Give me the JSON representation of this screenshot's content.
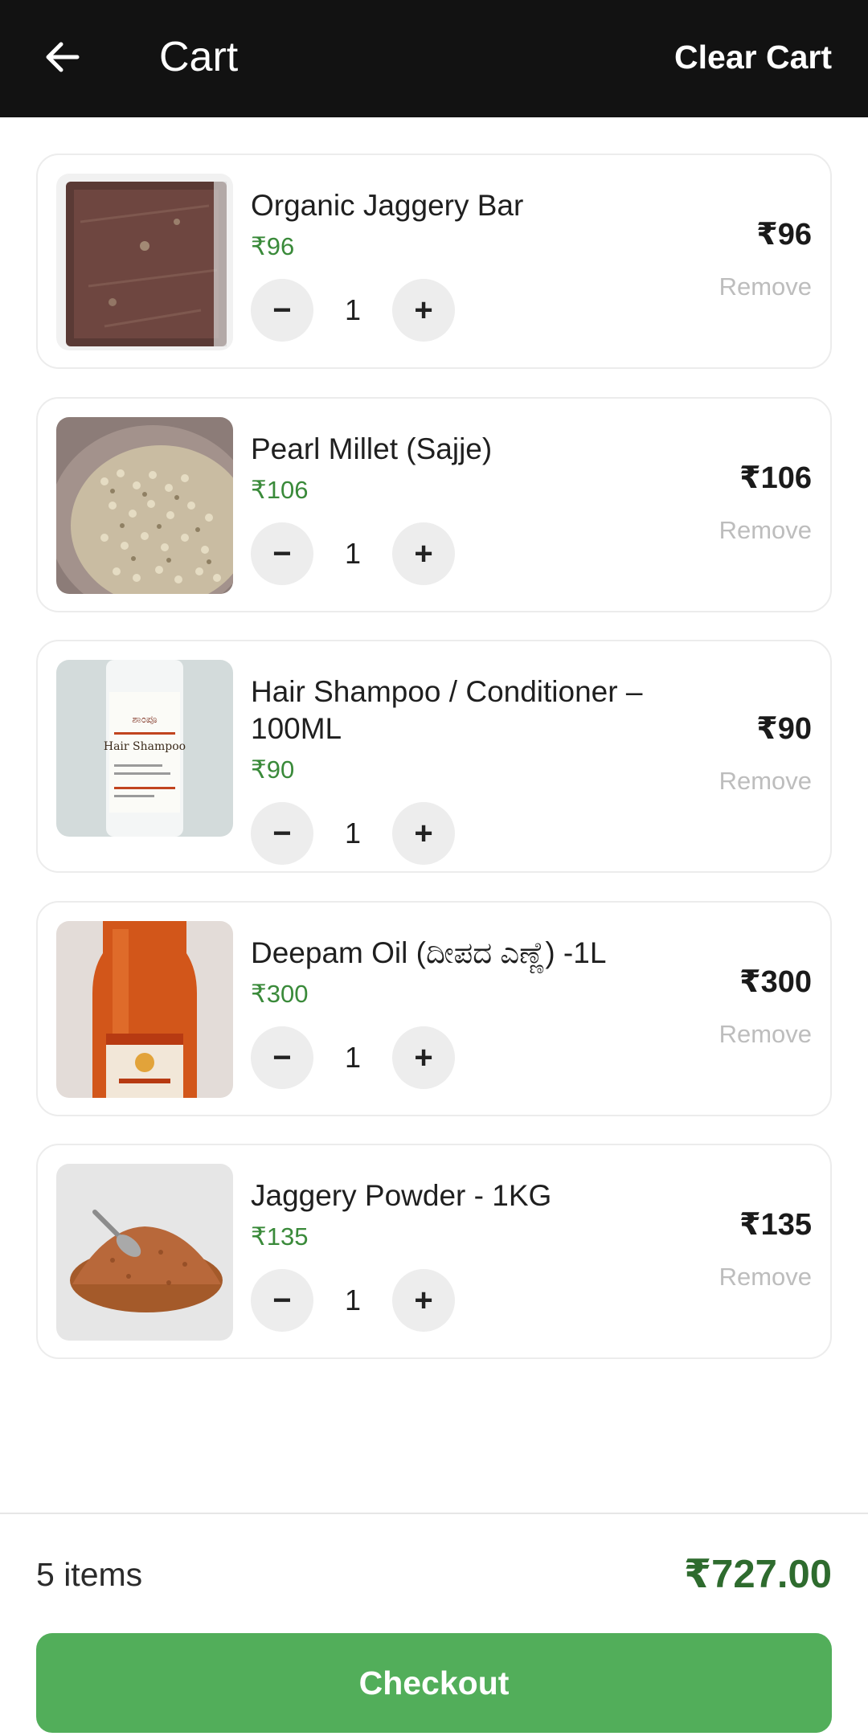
{
  "header": {
    "title": "Cart",
    "clear_label": "Clear Cart"
  },
  "items": [
    {
      "name": "Organic Jaggery Bar",
      "unit_price": "₹96",
      "quantity": "1",
      "line_total": "₹96",
      "remove_label": "Remove",
      "image": "jaggery-bar-image"
    },
    {
      "name": "Pearl Millet (Sajje)",
      "unit_price": "₹106",
      "quantity": "1",
      "line_total": "₹106",
      "remove_label": "Remove",
      "image": "pearl-millet-image"
    },
    {
      "name": "Hair Shampoo / Conditioner – 100ML",
      "unit_price": "₹90",
      "quantity": "1",
      "line_total": "₹90",
      "remove_label": "Remove",
      "image": "hair-shampoo-image",
      "label_text_kn": "ಶಾಂಪೂ",
      "label_text_en": "Hair Shampoo"
    },
    {
      "name": "Deepam Oil (ದೀಪದ ಎಣ್ಣೆ) -1L",
      "unit_price": "₹300",
      "quantity": "1",
      "line_total": "₹300",
      "remove_label": "Remove",
      "image": "deepam-oil-image"
    },
    {
      "name": "Jaggery Powder - 1KG",
      "unit_price": "₹135",
      "quantity": "1",
      "line_total": "₹135",
      "remove_label": "Remove",
      "image": "jaggery-powder-image"
    }
  ],
  "controls": {
    "minus_symbol": "−",
    "plus_symbol": "+"
  },
  "footer": {
    "item_count": "5 items",
    "total": "₹727.00",
    "checkout_label": "Checkout"
  },
  "colors": {
    "header_bg": "#121212",
    "price_green": "#3a8a3a",
    "total_green": "#2e6b2e",
    "checkout_green": "#52ae5a",
    "remove_gray": "#bdbdbd"
  }
}
